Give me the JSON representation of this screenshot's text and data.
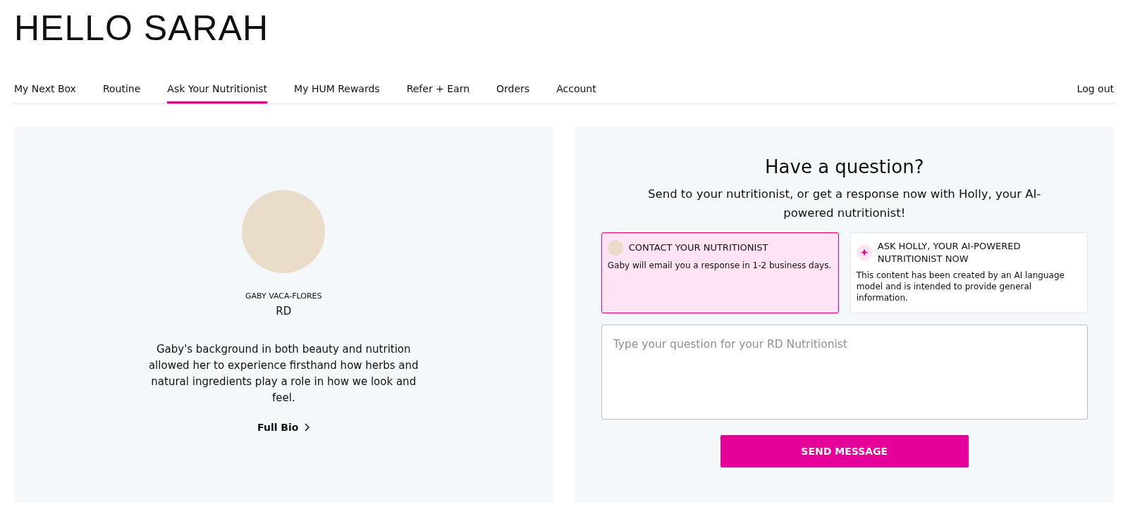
{
  "greeting": "HELLO SARAH",
  "tabs": [
    {
      "label": "My Next Box",
      "selected": false
    },
    {
      "label": "Routine",
      "selected": false
    },
    {
      "label": "Ask Your Nutritionist",
      "selected": true
    },
    {
      "label": "My HUM Rewards",
      "selected": false
    },
    {
      "label": "Refer + Earn",
      "selected": false
    },
    {
      "label": "Orders",
      "selected": false
    },
    {
      "label": "Account",
      "selected": false
    }
  ],
  "logout": "Log out",
  "nutritionist": {
    "name": "GABY VACA-FLORES",
    "credential": "RD",
    "bio": "Gaby's background in both beauty and nutrition allowed her to experience firsthand how herbs and natural ingredients play a role in how we look and feel.",
    "link": "Full Bio"
  },
  "question": {
    "title": "Have a question?",
    "subtitle": "Send to your nutritionist, or get a response now with Holly, your AI-powered nutritionist!",
    "options": [
      {
        "kind": "person",
        "title": "CONTACT YOUR NUTRITIONIST",
        "text": "Gaby will email you a response in 1-2 business days.",
        "selected": true
      },
      {
        "kind": "ai",
        "title": "ASK HOLLY, YOUR AI-POWERED NUTRITIONIST NOW",
        "text": "This content has been created by an AI language model and is intended to provide general information.",
        "selected": false
      }
    ],
    "placeholder": "Type your question for your RD Nutritionist",
    "button": "SEND MESSAGE"
  }
}
